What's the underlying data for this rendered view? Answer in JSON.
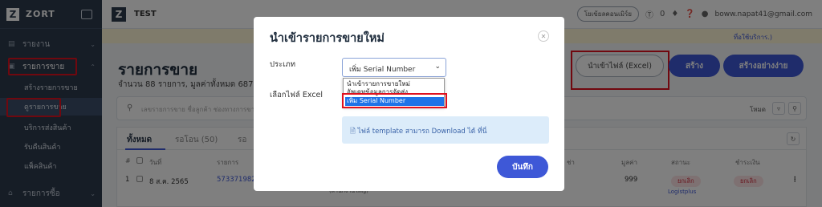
{
  "sidebar": {
    "brand": "ZORT",
    "logo_letter": "Z",
    "items": [
      {
        "label": "รายงาน",
        "icon": "chart-icon"
      },
      {
        "label": "รายการขาย",
        "icon": "cart-icon"
      },
      {
        "label": "รายการซื้อ",
        "icon": "shop-icon"
      }
    ],
    "sub_items": [
      {
        "label": "สร้างรายการขาย"
      },
      {
        "label": "ดูรายการขาย"
      },
      {
        "label": "บริการส่งสินค้า"
      },
      {
        "label": "รับคืนสินค้า"
      },
      {
        "label": "แพ็คสินค้า"
      }
    ]
  },
  "topbar": {
    "logo_letter": "Z",
    "company": "TEST",
    "pill_label": "โยเข้ยลคอนเมิร์ย",
    "notification_count": "0",
    "user_email": "boww.napat41@gmail.com"
  },
  "notice": {
    "text": "ที่อใช้บริการ.)"
  },
  "main": {
    "title": "รายการขาย",
    "subtitle": "จำนวน 88 รายการ, มูลค่าทั้งหมด 687,3",
    "buttons": {
      "import_excel": "นำเข้าไฟล์ (Excel)",
      "create": "สร้าง",
      "create_easy": "สร้างอย่างง่าย"
    },
    "search_placeholder": "เลขรายการขาย ชื่อลูกค้า ช่องทางการขาย",
    "search_right_label": "โหมด",
    "tabs": [
      "ทั้งหมด",
      "รอโอน (50)",
      "รอ"
    ],
    "table": {
      "headers": [
        "#",
        "วันที่",
        "รายการ",
        "ช่า",
        "มูลค่า",
        "สถานะ",
        "ชำระเงิน"
      ],
      "row": {
        "index": "1",
        "date": "8 ส.ค. 2565",
        "order": "573371982",
        "customer": "(สำนักงานใหญ่)",
        "value": "999",
        "status": "ยกเลิก",
        "status_sub": "Logistplus",
        "payment": "ยกเลิก"
      }
    }
  },
  "modal": {
    "title": "นำเข้ารายการขายใหม่",
    "type_label": "ประเภท",
    "type_value": "เพิ่ม Serial Number",
    "file_label": "เลือกไฟล์ Excel",
    "options": [
      "นำเข้ารายการขายใหม่",
      "อัพเดทข้อมูลการจัดส่ง",
      "เพิ่ม Serial Number"
    ],
    "info_text": "ไฟล์ template สามารถ Download ได้ ที่นี่",
    "save_label": "บันทึก"
  },
  "colors": {
    "sidebar": "#2d3a4d",
    "primary": "#3e58d7",
    "highlight": "#e0101e",
    "info_bg": "#dcecfa",
    "selected_option": "#1e73e8"
  }
}
